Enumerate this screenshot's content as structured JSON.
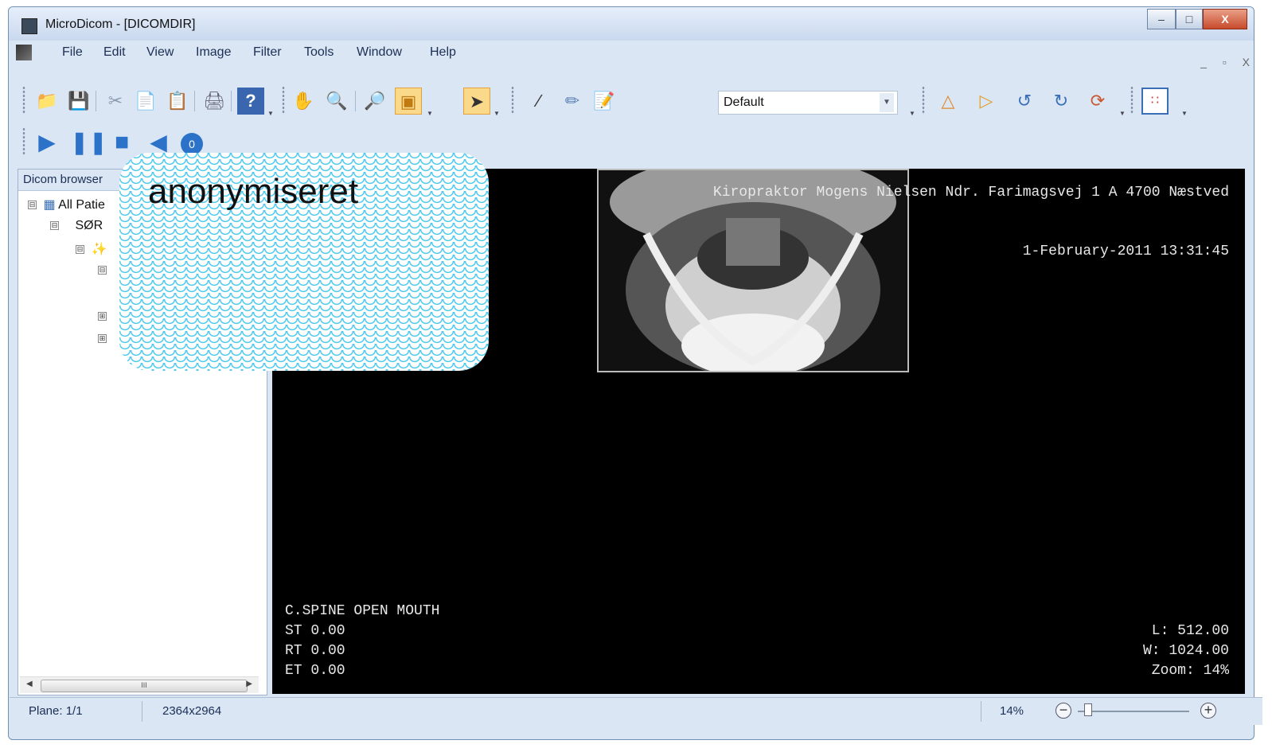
{
  "window": {
    "title": "MicroDicom - [DICOMDIR]",
    "minimize": "–",
    "maximize": "□",
    "close": "X"
  },
  "menu": {
    "items": [
      "File",
      "Edit",
      "View",
      "Image",
      "Filter",
      "Tools",
      "Window",
      "Help"
    ],
    "mdi_controls": "_ ▫ X"
  },
  "toolbar": {
    "preset_value": "Default",
    "icons": [
      "open-folder",
      "save",
      "cut",
      "copy",
      "paste",
      "print",
      "help",
      "pan-hand",
      "zoom",
      "zoom-1to1",
      "fit-window",
      "select-arrow",
      "line",
      "pencil",
      "annotation",
      "flip-horizontal",
      "flip-vertical",
      "rotate-left",
      "rotate-right",
      "reset",
      "fullscreen"
    ],
    "playback_icons": [
      "play",
      "pause",
      "stop",
      "previous",
      "counter"
    ],
    "counter_text": "0"
  },
  "browser": {
    "title": "Dicom browser",
    "tree": [
      {
        "label": "All Patie",
        "expander": "⊟"
      },
      {
        "label": "SØR",
        "expander": "⊟"
      },
      {
        "label": "",
        "expander": "⊟"
      },
      {
        "label": "",
        "expander": "⊟"
      },
      {
        "label": "",
        "expander": "⊞"
      },
      {
        "label": "",
        "expander": "⊞"
      }
    ],
    "scroll_thumb": "III"
  },
  "overlay": {
    "text": "anonymiseret",
    "color": "#4fc9ee"
  },
  "viewer": {
    "top_right_1": "Kiropraktor Mogens Nielsen Ndr. Farimagsvej 1 A 4700 Næstved",
    "top_right_2": "1-February-2011 13:31:45",
    "bottom_left": [
      "C.SPINE OPEN MOUTH",
      "ST 0.00",
      "RT 0.00",
      "ET 0.00"
    ],
    "bottom_right": [
      "L: 512.00",
      "W: 1024.00",
      "Zoom: 14%"
    ]
  },
  "status": {
    "plane": "Plane: 1/1",
    "dimensions": "2364x2964",
    "zoom": "14%",
    "zoom_level": 0.14
  }
}
